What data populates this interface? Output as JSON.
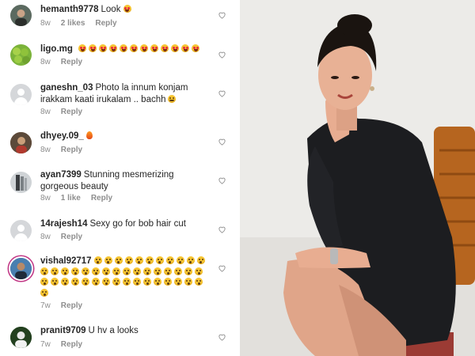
{
  "comments": [
    {
      "username": "hemanth9778",
      "text": "Look",
      "emoji": [
        "heart-eyes"
      ],
      "time": "8w",
      "likes": "2 likes",
      "reply": "Reply"
    },
    {
      "username": "ligo.mg",
      "text": "",
      "emoji": [
        "heart-eyes",
        "heart-eyes",
        "heart-eyes",
        "heart-eyes",
        "heart-eyes",
        "heart-eyes",
        "heart-eyes",
        "heart-eyes",
        "heart-eyes",
        "heart-eyes",
        "heart-eyes",
        "heart-eyes"
      ],
      "time": "8w",
      "likes": "",
      "reply": "Reply"
    },
    {
      "username": "ganeshn_03",
      "text": "Photo la innum konjam irakkam kaati irukalam .. bachh",
      "emoji": [
        "hug"
      ],
      "time": "8w",
      "likes": "",
      "reply": "Reply"
    },
    {
      "username": "dhyey.09_",
      "text": "",
      "emoji": [
        "fire"
      ],
      "time": "8w",
      "likes": "",
      "reply": "Reply"
    },
    {
      "username": "ayan7399",
      "text": "Stunning mesmerizing gorgeous beauty",
      "emoji": [],
      "time": "8w",
      "likes": "1 like",
      "reply": "Reply"
    },
    {
      "username": "14rajesh14",
      "text": "Sexy go for bob hair cut",
      "emoji": [],
      "time": "8w",
      "likes": "",
      "reply": "Reply"
    },
    {
      "username": "vishal92717",
      "text": "",
      "emoji_count": 44,
      "emoji_type": "wow",
      "time": "7w",
      "likes": "",
      "reply": "Reply"
    },
    {
      "username": "pranit9709",
      "text": "U hv a looks",
      "emoji": [],
      "time": "7w",
      "likes": "",
      "reply": "Reply"
    }
  ],
  "photo": {
    "subject": "woman in black blazer seated on wooden chair, hand on cheek"
  },
  "colors": {
    "username": "#262626",
    "meta": "#8e8e8e",
    "heart": "#8e8e8e",
    "story_ring": "#c13584"
  }
}
